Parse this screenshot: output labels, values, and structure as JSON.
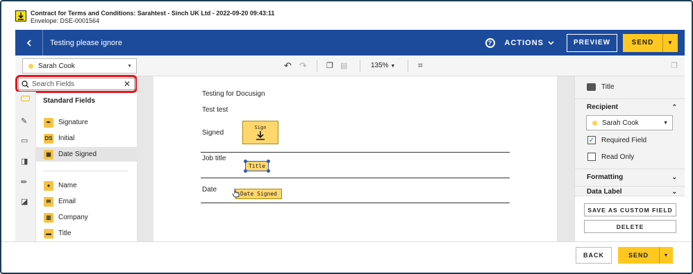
{
  "header": {
    "title": "Contract for Terms and Conditions: Sarahtest - Sinch UK Ltd - 2022-09-20 09:43:11",
    "envelope": "Envelope: DSE-0001564"
  },
  "topbar": {
    "title": "Testing please ignore",
    "actions_label": "ACTIONS",
    "preview_label": "PREVIEW",
    "send_label": "SEND",
    "accent": "#1c4b9c",
    "send_color": "#ffc820"
  },
  "toolbar": {
    "recipient": "Sarah Cook",
    "zoom": "135%"
  },
  "fields_panel": {
    "search_placeholder": "Search Fields",
    "section_title": "Standard Fields",
    "items": [
      {
        "label": "Signature",
        "icon": "pen-icon"
      },
      {
        "label": "Initial",
        "icon": "DS"
      },
      {
        "label": "Date Signed",
        "icon": "calendar-icon",
        "selected": true
      },
      {
        "label": "Name",
        "icon": "person-icon"
      },
      {
        "label": "Email",
        "icon": "envelope-icon"
      },
      {
        "label": "Company",
        "icon": "building-icon"
      },
      {
        "label": "Title",
        "icon": "briefcase-icon"
      }
    ]
  },
  "document": {
    "line1": "Testing for Docusign",
    "line2": "Test test",
    "signed_label": "Signed",
    "sign_tag": "Sign",
    "job_title_label": "Job title",
    "title_tag": "Title",
    "date_label": "Date",
    "date_tag": "Date Signed"
  },
  "properties": {
    "field_type": "Title",
    "recipient_heading": "Recipient",
    "recipient_value": "Sarah Cook",
    "required_label": "Required Field",
    "required_checked": true,
    "readonly_label": "Read Only",
    "readonly_checked": false,
    "formatting_heading": "Formatting",
    "data_label_heading": "Data Label",
    "save_custom_label": "SAVE AS CUSTOM FIELD",
    "delete_label": "DELETE"
  },
  "footer": {
    "back_label": "BACK",
    "send_label": "SEND"
  }
}
